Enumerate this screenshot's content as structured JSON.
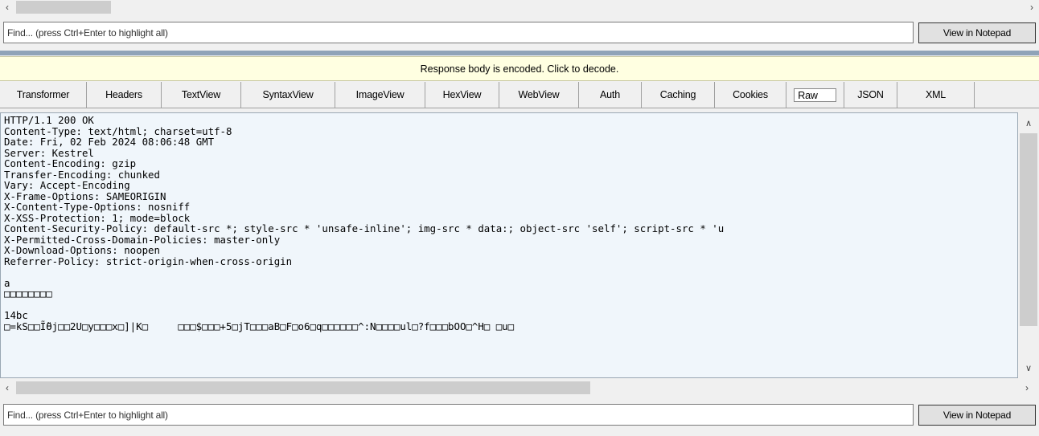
{
  "top_pane": {
    "find_placeholder": "Find... (press Ctrl+Enter to highlight all)",
    "notepad_button": "View in Notepad"
  },
  "banner": {
    "text": "Response body is encoded. Click to decode."
  },
  "tabs": [
    {
      "label": "Transformer"
    },
    {
      "label": "Headers"
    },
    {
      "label": "TextView"
    },
    {
      "label": "SyntaxView"
    },
    {
      "label": "ImageView"
    },
    {
      "label": "HexView"
    },
    {
      "label": "WebView"
    },
    {
      "label": "Auth"
    },
    {
      "label": "Caching"
    },
    {
      "label": "Cookies"
    },
    {
      "label": "Raw"
    },
    {
      "label": "JSON"
    },
    {
      "label": "XML"
    }
  ],
  "active_tab": "Raw",
  "response": {
    "lines": [
      "HTTP/1.1 200 OK",
      "Content-Type: text/html; charset=utf-8",
      "Date: Fri, 02 Feb 2024 08:06:48 GMT",
      "Server: Kestrel",
      "Content-Encoding: gzip",
      "Transfer-Encoding: chunked",
      "Vary: Accept-Encoding",
      "X-Frame-Options: SAMEORIGIN",
      "X-Content-Type-Options: nosniff",
      "X-XSS-Protection: 1; mode=block",
      "Content-Security-Policy: default-src *; style-src * 'unsafe-inline'; img-src * data:; object-src 'self'; script-src * 'u",
      "X-Permitted-Cross-Domain-Policies: master-only",
      "X-Download-Options: noopen",
      "Referrer-Policy: strict-origin-when-cross-origin",
      "",
      "a",
      "□□□□□□□□",
      "",
      "14bc",
      "□=kS□□Ĩ̃ϴj□□2U□y□□□x□]|K□     □□□$□□□+5□jT□□□aB□F□o6□q□□□□□□^:N□□□□ul□?f□□□bOO□^H□ □u□"
    ]
  },
  "bottom_pane": {
    "find_placeholder": "Find... (press Ctrl+Enter to highlight all)",
    "notepad_button": "View in Notepad"
  },
  "scroll": {
    "top_h_position": 0.0,
    "body_v_position": 0.0,
    "body_h_position": 0.0
  }
}
